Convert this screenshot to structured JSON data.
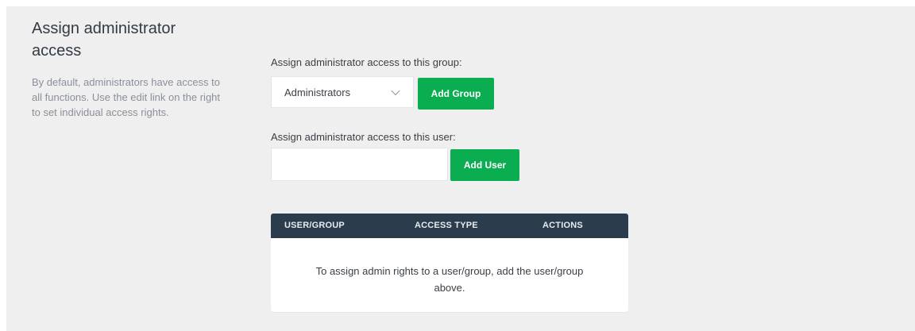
{
  "section": {
    "title": "Assign administrator access",
    "description": "By default, administrators have access to all functions. Use the edit link on the right to set individual access rights."
  },
  "group_assign": {
    "label": "Assign administrator access to this group:",
    "selected_group": "Administrators",
    "button_label": "Add Group"
  },
  "user_assign": {
    "label": "Assign administrator access to this user:",
    "input_value": "",
    "button_label": "Add User"
  },
  "table": {
    "columns": [
      "USER/GROUP",
      "ACCESS TYPE",
      "ACTIONS"
    ],
    "empty_message": "To assign admin rights to a user/group, add the user/group above."
  },
  "colors": {
    "accent_green": "#0aad4f",
    "table_header": "#2b3c4d",
    "panel_bg": "#efeff0"
  }
}
